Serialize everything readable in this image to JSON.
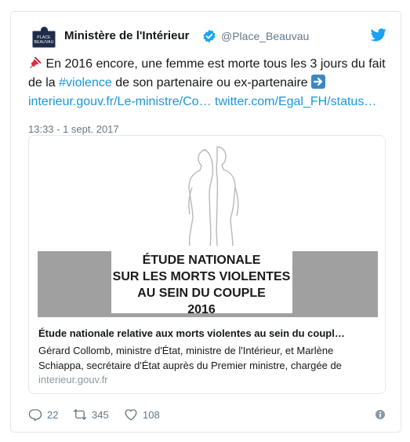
{
  "tweet": {
    "account": {
      "avatar_text": "PLACE BEAUVAU",
      "name": "Ministère de l'Intérieur",
      "handle": "@Place_Beauvau",
      "verified": true
    },
    "text_part1": "En 2016 encore, une femme est morte tous les 3 jours du fait de la ",
    "hashtag": "#violence",
    "text_part2": " de son partenaire ou ex-partenaire ",
    "link1": "interieur.gouv.fr/Le-ministre/Co…",
    "link2": "twitter.com/Egal_FH/status…",
    "timestamp": "13:33 - 1 sept. 2017",
    "card": {
      "image_text": [
        "ÉTUDE NATIONALE",
        "SUR LES MORTS VIOLENTES",
        "AU SEIN DU COUPLE",
        "2016"
      ],
      "title": "Étude nationale relative aux morts violentes au sein du coupl…",
      "description": "Gérard Collomb, ministre d'État, ministre de l'Intérieur, et Marlène Schiappa, secrétaire d'État auprès du Premier ministre, chargée de",
      "domain": "interieur.gouv.fr"
    },
    "actions": {
      "replies": "22",
      "retweets": "345",
      "likes": "108"
    }
  },
  "colors": {
    "link": "#1b95e0",
    "verified": "#1da1f2",
    "muted": "#657786",
    "banner_gray": "#a0a0a0"
  },
  "icons": [
    "pushpin-icon",
    "right-arrow-icon",
    "verified-badge-icon",
    "twitter-bird-icon",
    "reply-icon",
    "retweet-icon",
    "heart-icon",
    "info-icon"
  ]
}
